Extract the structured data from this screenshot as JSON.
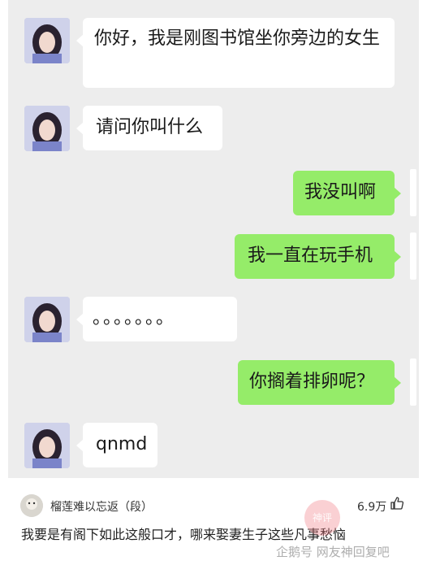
{
  "messages": [
    {
      "side": "left",
      "text": "你好，我是刚图书馆坐你旁边的女生"
    },
    {
      "side": "left",
      "text": "请问你叫什么"
    },
    {
      "side": "right",
      "text": "我没叫啊"
    },
    {
      "side": "right",
      "text": "我一直在玩手机"
    },
    {
      "side": "left",
      "text": "。。。。。。。"
    },
    {
      "side": "right",
      "text": "你搁着排卵呢？"
    },
    {
      "side": "left",
      "text": "qnmd"
    }
  ],
  "comment": {
    "username": "榴莲难以忘返（段）",
    "likes": "6.9万",
    "text": "我要是有阁下如此这般口才，哪来娶妻生子这些凡事愁恼"
  },
  "stamp": "神评",
  "watermark": "企鹅号 网友神回复吧",
  "colors": {
    "chat_bg": "#ededed",
    "left_bubble": "#ffffff",
    "right_bubble": "#95ec69"
  }
}
